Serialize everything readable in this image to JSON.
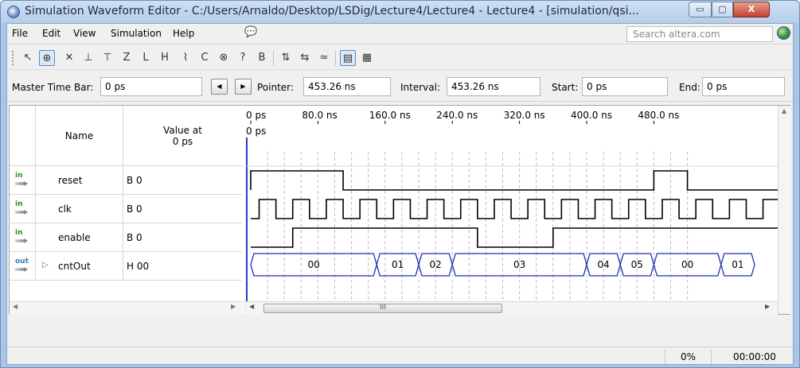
{
  "window": {
    "title": "Simulation Waveform Editor - C:/Users/Arnaldo/Desktop/LSDig/Lecture4/Lecture4 - Lecture4 - [simulation/qsi...",
    "min_glyph": "▭",
    "max_glyph": "▢",
    "close_glyph": "X"
  },
  "menu": {
    "items": [
      "File",
      "Edit",
      "View",
      "Simulation",
      "Help"
    ],
    "search_placeholder": "Search altera.com"
  },
  "toolbar": {
    "icons": [
      "pointer-tool-icon",
      "zoom-tool-icon",
      "force-unknown-icon",
      "force-low-icon",
      "force-high-icon",
      "force-high-impedance-icon",
      "force-weak-low-icon",
      "force-weak-high-icon",
      "invert-icon",
      "count-value-icon",
      "overwrite-clock-icon",
      "random-values-icon",
      "arbitrary-value-icon",
      "sort-icon",
      "snap-to-grid-icon",
      "grid-size-icon",
      "filter-icon",
      "display-group-icon",
      "save-icon"
    ]
  },
  "timebar": {
    "master_label": "Master Time Bar:",
    "master_value": "0 ps",
    "pointer_label": "Pointer:",
    "pointer_value": "453.26 ns",
    "interval_label": "Interval:",
    "interval_value": "453.26 ns",
    "start_label": "Start:",
    "start_value": "0 ps",
    "end_label": "End:",
    "end_value": "0 ps",
    "prev_glyph": "◀",
    "next_glyph": "▶"
  },
  "grid": {
    "name_header": "Name",
    "value_header_line1": "Value at",
    "value_header_line2": "0 ps",
    "rows": [
      {
        "pin": "in",
        "name": "reset",
        "value": "B 0"
      },
      {
        "pin": "in",
        "name": "clk",
        "value": "B 0"
      },
      {
        "pin": "in",
        "name": "enable",
        "value": "B 0"
      },
      {
        "pin": "out",
        "name": "cntOut",
        "value": "H 00"
      }
    ],
    "scroll_left": "◀",
    "scroll_right": "▶",
    "scroll_grip": "III"
  },
  "waveform": {
    "time_labels": [
      "0 ps",
      "80.0 ns",
      "160.0 ns",
      "240.0 ns",
      "320.0 ns",
      "400.0 ns",
      "480.0 ns"
    ],
    "cursor_label": "0 ps",
    "bus_values": [
      "00",
      "01",
      "02",
      "03",
      "04",
      "05",
      "00",
      "01"
    ],
    "colors": {
      "signal": "#000000",
      "bus": "#1f2fb0",
      "cursor": "#2a3cc8",
      "grid": "#bdbdbd"
    }
  },
  "status": {
    "progress": "0%",
    "elapsed": "00:00:00"
  }
}
